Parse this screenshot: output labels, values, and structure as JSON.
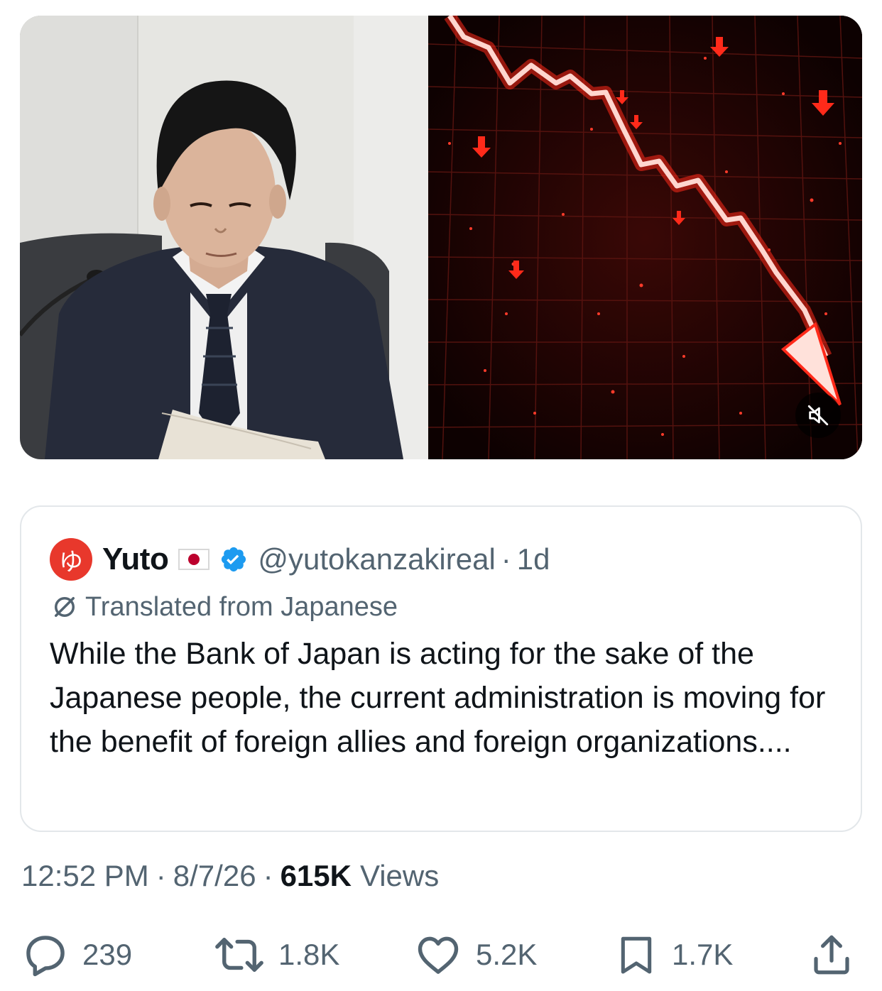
{
  "media": {
    "mute_icon": "speaker-muted-icon"
  },
  "quote": {
    "avatar_text": "ゆ",
    "author_name": "Yuto",
    "flag_icon": "japan-flag-icon",
    "verified_icon": "verified-badge-icon",
    "handle": "@yutokanzakireal",
    "separator": "·",
    "age": "1d",
    "translated_label": "Translated from Japanese",
    "text": "While the Bank of Japan is acting for the sake of the Japanese people, the current administration is moving for the benefit of foreign allies and foreign organizations...."
  },
  "meta": {
    "time": "12:52 PM",
    "separator": "·",
    "date": "8/7/26",
    "views_count": "615K",
    "views_label": "Views"
  },
  "actions": {
    "replies": "239",
    "reposts": "1.8K",
    "likes": "5.2K",
    "bookmarks": "1.7K"
  },
  "colors": {
    "text_primary": "#0f1419",
    "text_secondary": "#536471",
    "verified_blue": "#1d9bf0",
    "avatar_red": "#e8382c",
    "chart_red": "#ff2a1a"
  }
}
